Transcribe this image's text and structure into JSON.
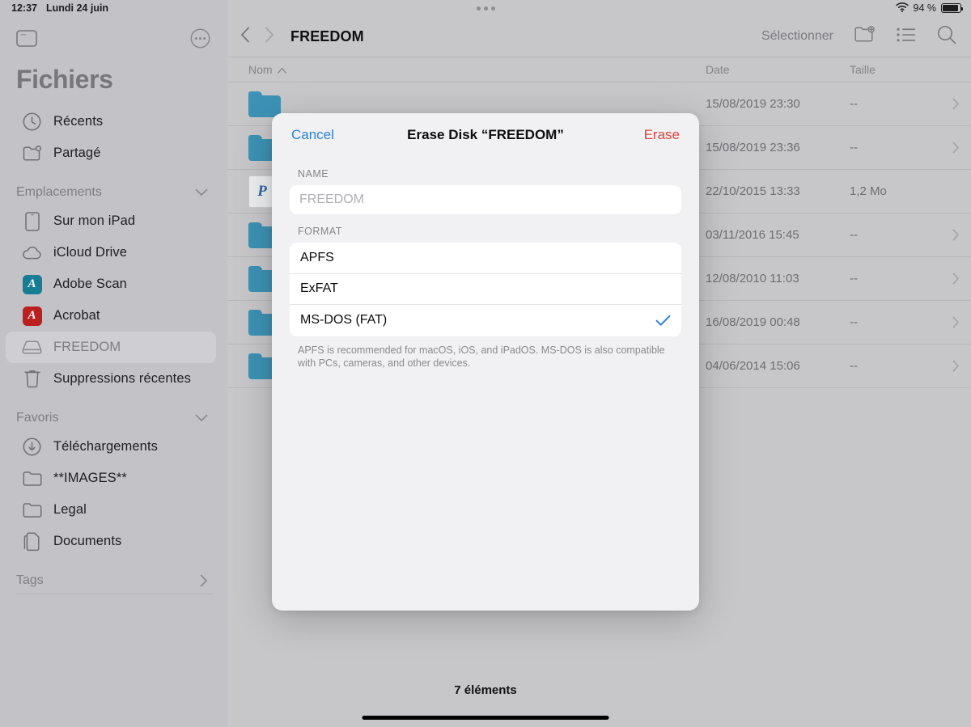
{
  "status_bar": {
    "time": "12:37",
    "date": "Lundi 24 juin",
    "battery_percent": "94 %",
    "wifi_icon": "wifi-icon",
    "battery_icon": "battery-icon",
    "multitask_handle": "multitask-handle-icon"
  },
  "sidebar": {
    "title": "Fichiers",
    "toolbar": {
      "sidebar_toggle_icon": "sidebar-toggle-icon",
      "more_icon": "more-ellipsis-icon"
    },
    "top_items": [
      {
        "label": "Récents",
        "icon": "clock-icon"
      },
      {
        "label": "Partagé",
        "icon": "shared-folder-icon"
      }
    ],
    "sections": [
      {
        "title": "Emplacements",
        "chevron": "chevron-down-icon",
        "items": [
          {
            "label": "Sur mon iPad",
            "icon": "ipad-icon",
            "selected": false
          },
          {
            "label": "iCloud Drive",
            "icon": "cloud-icon",
            "selected": false
          },
          {
            "label": "Adobe Scan",
            "icon": "adobe-scan-app-icon",
            "badge_color": "#157e95",
            "badge_glyph": "A",
            "selected": false
          },
          {
            "label": "Acrobat",
            "icon": "acrobat-app-icon",
            "badge_color": "#bb1f1f",
            "badge_glyph": "A",
            "selected": false
          },
          {
            "label": "FREEDOM",
            "icon": "external-drive-icon",
            "selected": true
          },
          {
            "label": "Suppressions récentes",
            "icon": "trash-icon",
            "selected": false
          }
        ]
      },
      {
        "title": "Favoris",
        "chevron": "chevron-down-icon",
        "items": [
          {
            "label": "Téléchargements",
            "icon": "download-circle-icon",
            "selected": false
          },
          {
            "label": "**IMAGES**",
            "icon": "folder-icon",
            "selected": false
          },
          {
            "label": "Legal",
            "icon": "folder-icon",
            "selected": false
          },
          {
            "label": "Documents",
            "icon": "documents-icon",
            "selected": false
          }
        ]
      }
    ],
    "tags": {
      "title": "Tags",
      "chevron": "chevron-right-icon"
    }
  },
  "main": {
    "toolbar": {
      "back_icon": "chevron-left-icon",
      "forward_icon": "chevron-right-icon",
      "title": "FREEDOM",
      "select_label": "Sélectionner",
      "new_folder_icon": "new-folder-icon",
      "list_view_icon": "list-view-icon",
      "search_icon": "search-icon"
    },
    "columns": {
      "name": "Nom",
      "name_sort_icon": "sort-ascending-caret",
      "date": "Date",
      "size": "Taille"
    },
    "rows": [
      {
        "name": "",
        "icon": "folder-icon",
        "date": "15/08/2019 23:30",
        "size": "--",
        "chevron": "chevron-right-icon"
      },
      {
        "name": "",
        "icon": "folder-icon",
        "date": "15/08/2019 23:36",
        "size": "--",
        "chevron": "chevron-right-icon"
      },
      {
        "name": "",
        "icon": "pdf-file-icon",
        "date": "22/10/2015 13:33",
        "size": "1,2 Mo",
        "chevron": ""
      },
      {
        "name": "",
        "icon": "folder-icon",
        "date": "03/11/2016 15:45",
        "size": "--",
        "chevron": "chevron-right-icon"
      },
      {
        "name": "",
        "icon": "folder-icon",
        "date": "12/08/2010 11:03",
        "size": "--",
        "chevron": "chevron-right-icon"
      },
      {
        "name": "",
        "icon": "folder-icon",
        "date": "16/08/2019 00:48",
        "size": "--",
        "chevron": "chevron-right-icon"
      },
      {
        "name": "",
        "icon": "folder-icon",
        "date": "04/06/2014 15:06",
        "size": "--",
        "chevron": "chevron-right-icon"
      }
    ],
    "item_count": "7 éléments"
  },
  "modal": {
    "cancel_label": "Cancel",
    "title": "Erase Disk “FREEDOM”",
    "erase_label": "Erase",
    "name_section_label": "NAME",
    "name_value": "",
    "name_placeholder": "FREEDOM",
    "format_section_label": "FORMAT",
    "formats": [
      {
        "label": "APFS",
        "selected": false
      },
      {
        "label": "ExFAT",
        "selected": false
      },
      {
        "label": "MS-DOS (FAT)",
        "selected": true
      }
    ],
    "format_note": "APFS is recommended for macOS, iOS, and iPadOS. MS-DOS is also compatible with PCs, cameras, and other devices.",
    "check_icon": "checkmark-icon"
  },
  "colors": {
    "accent_blue": "#2b82d9",
    "destructive_red": "#e0443e",
    "folder_blue": "#3d92b5",
    "sidebar_bg": "#c3c3c7",
    "main_bg": "#c7c7ca",
    "modal_bg": "#f1f1f4"
  }
}
